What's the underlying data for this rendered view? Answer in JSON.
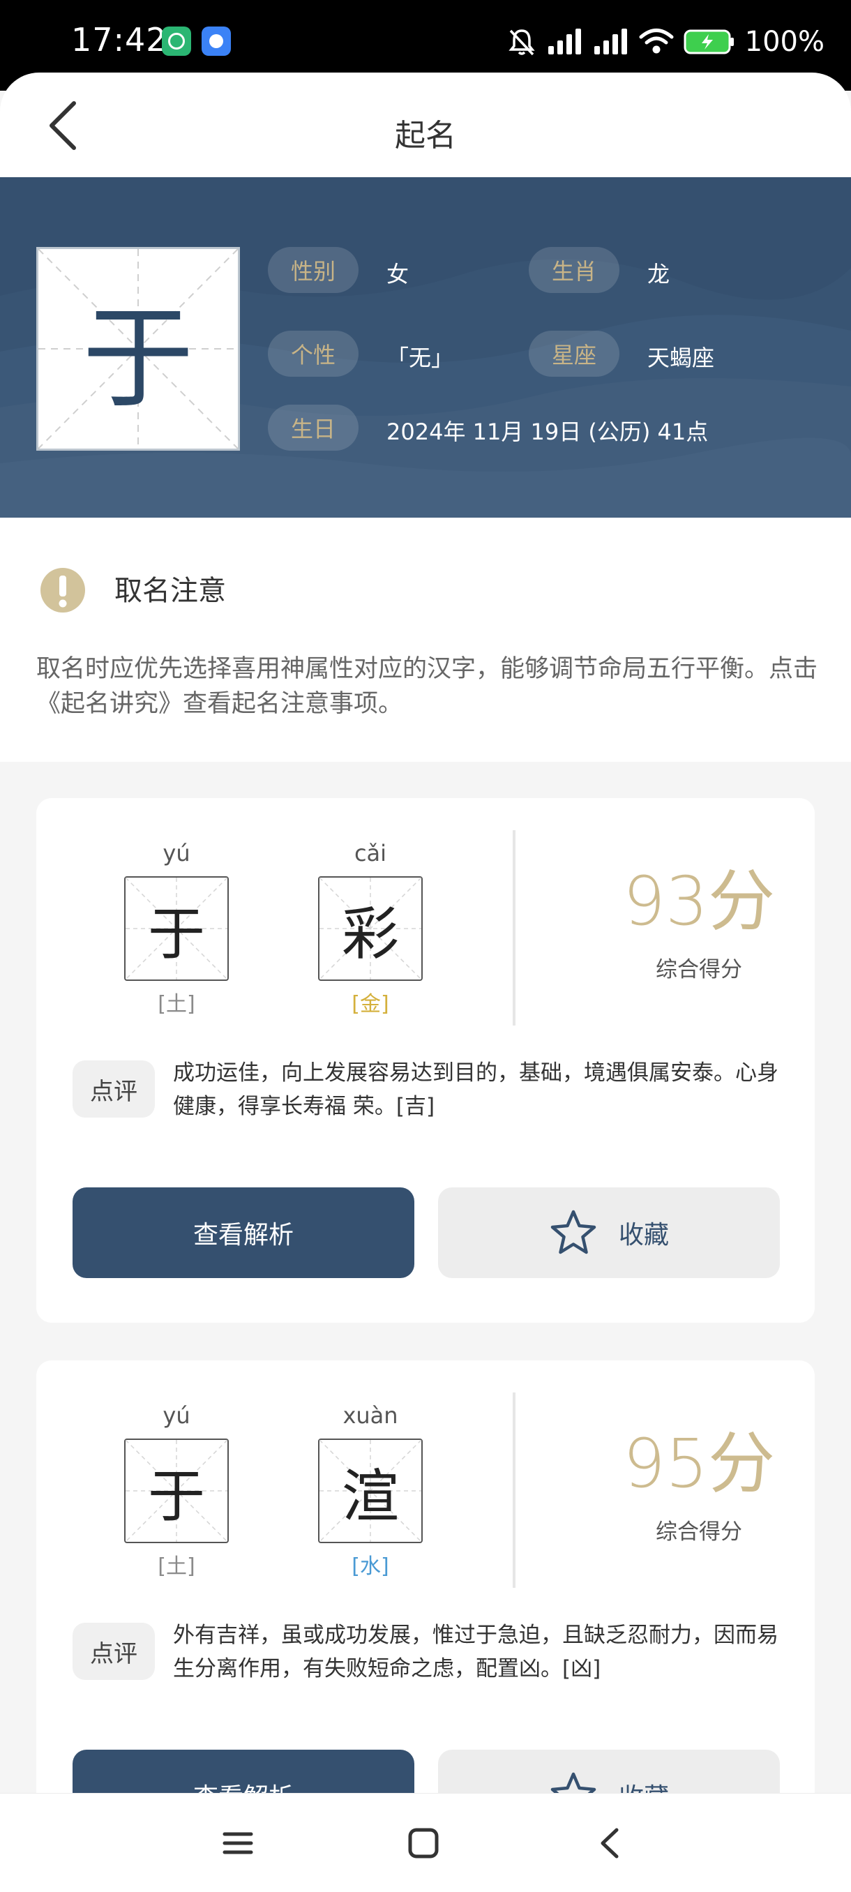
{
  "status_bar": {
    "time": "17:42",
    "battery": "100%",
    "icons": [
      "mute-icon",
      "signal-icon",
      "signal-icon",
      "wifi-icon",
      "battery-icon"
    ]
  },
  "header": {
    "title": "起名",
    "back_icon": "chevron-left-icon"
  },
  "profile": {
    "character": "于",
    "gender_label": "性别",
    "gender": "女",
    "zodiac_label": "生肖",
    "zodiac": "龙",
    "personality_label": "个性",
    "personality": "「无」",
    "constellation_label": "星座",
    "constellation": "天蝎座",
    "birthday_label": "生日",
    "birthday": "2024年 11月 19日 (公历) 41点"
  },
  "notice": {
    "title": "取名注意",
    "text": "取名时应优先选择喜用神属性对应的汉字，能够调节命局五行平衡。点击《起名讲究》查看起名注意事项。"
  },
  "cards": [
    {
      "chars": [
        {
          "pinyin": "yú",
          "char": "于",
          "element": "[土]",
          "element_color": "#8a8a8a"
        },
        {
          "pinyin": "cǎi",
          "char": "彩",
          "element": "[金]",
          "element_color": "#d4b03c"
        }
      ],
      "score": "93分",
      "score_label": "综合得分",
      "review_tag": "点评",
      "review": "成功运佳，向上发展容易达到目的，基础，境遇俱属安泰。心身健康，得享长寿福 荣。[吉]",
      "view_button": "查看解析",
      "favorite_button": "收藏"
    },
    {
      "chars": [
        {
          "pinyin": "yú",
          "char": "于",
          "element": "[土]",
          "element_color": "#8a8a8a"
        },
        {
          "pinyin": "xuàn",
          "char": "渲",
          "element": "[水]",
          "element_color": "#4a9ad4"
        }
      ],
      "score": "95分",
      "score_label": "综合得分",
      "review_tag": "点评",
      "review": "外有吉祥，虽或成功发展，惟过于急迫，且缺乏忍耐力，因而易生分离作用，有失败短命之虑，配置凶。[凶]",
      "view_button": "查看解析",
      "favorite_button": "收藏"
    }
  ],
  "nav": {
    "icons": [
      "menu-icon",
      "home-icon",
      "back-icon"
    ]
  }
}
